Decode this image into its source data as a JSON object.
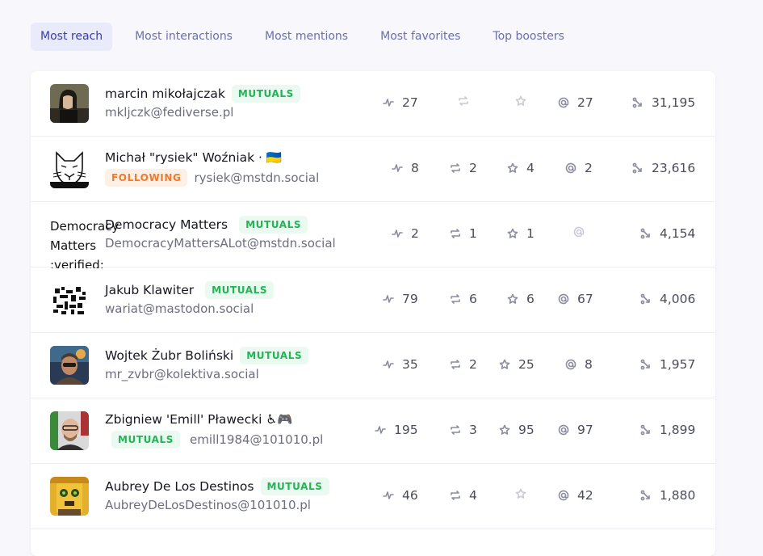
{
  "tabs": [
    {
      "label": "Most reach"
    },
    {
      "label": "Most interactions"
    },
    {
      "label": "Most mentions"
    },
    {
      "label": "Most favorites"
    },
    {
      "label": "Top boosters"
    }
  ],
  "rows": [
    {
      "name": "marcin mikołajczak",
      "badge": "MUTUALS",
      "handle": "mkljczk@fediverse.pl",
      "interactions": "27",
      "boosts": "",
      "favorites": "",
      "mentions": "27",
      "reach": "31,195"
    },
    {
      "name": "Michał \"rysiek\" Woźniak · 🇺🇦",
      "badge": "FOLLOWING",
      "handle": "rysiek@mstdn.social",
      "interactions": "8",
      "boosts": "2",
      "favorites": "4",
      "mentions": "2",
      "reach": "23,616"
    },
    {
      "avatar_alt": "Democracy Matters :verified:",
      "name": "Democracy Matters",
      "badge": "MUTUALS",
      "handle": "DemocracyMattersALot@mstdn.social",
      "interactions": "2",
      "boosts": "1",
      "favorites": "1",
      "mentions": "",
      "reach": "4,154"
    },
    {
      "name": "Jakub Klawiter",
      "badge": "MUTUALS",
      "handle": "wariat@mastodon.social",
      "interactions": "79",
      "boosts": "6",
      "favorites": "6",
      "mentions": "67",
      "reach": "4,006"
    },
    {
      "name": "Wojtek Żubr Boliński",
      "badge": "MUTUALS",
      "handle": "mr_zvbr@kolektiva.social",
      "interactions": "35",
      "boosts": "2",
      "favorites": "25",
      "mentions": "8",
      "reach": "1,957"
    },
    {
      "name": "Zbigniew 'Emill' Pławecki ♿🎮",
      "badge": "MUTUALS",
      "handle": "emill1984@101010.pl",
      "interactions": "195",
      "boosts": "3",
      "favorites": "95",
      "mentions": "97",
      "reach": "1,899"
    },
    {
      "name": "Aubrey De Los Destinos",
      "badge": "MUTUALS",
      "handle": "AubreyDeLosDestinos@101010.pl",
      "interactions": "46",
      "boosts": "4",
      "favorites": "",
      "mentions": "42",
      "reach": "1,880"
    }
  ],
  "icons": {
    "interactions": "activity-icon",
    "boosts": "repeat-icon",
    "favorites": "star-icon",
    "mentions": "at-icon",
    "reach": "share-icon"
  },
  "colors": {
    "accent": "#3a3fa8",
    "mutuals": "#22b455",
    "following": "#ef7a2a"
  }
}
